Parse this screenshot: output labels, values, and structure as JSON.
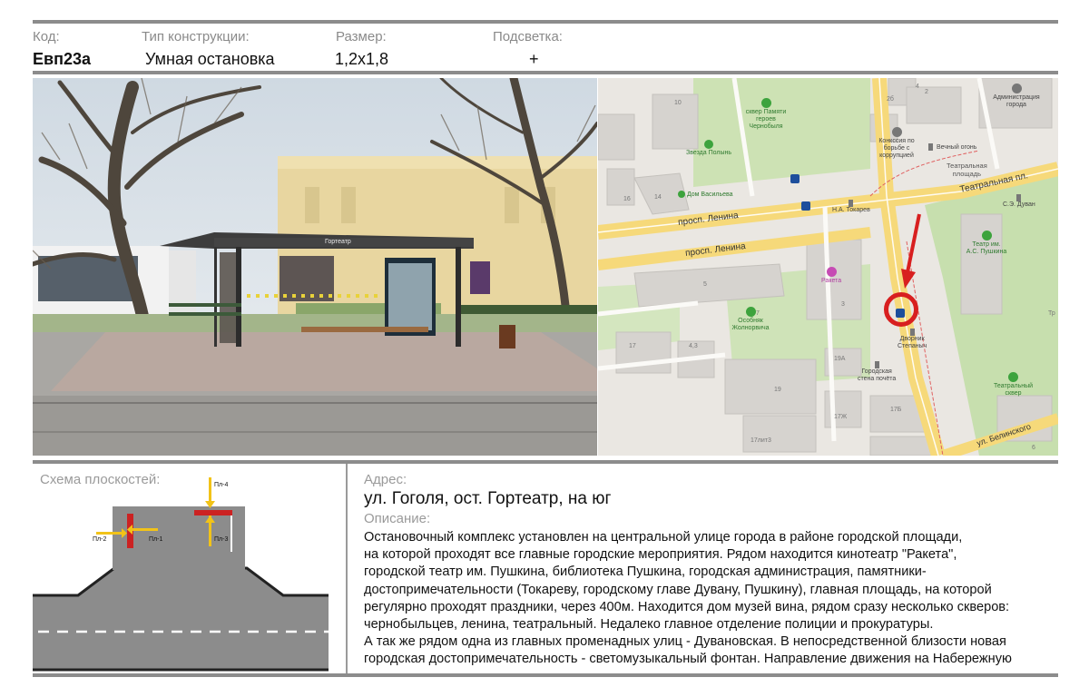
{
  "header": {
    "code_label": "Код:",
    "code_value": "Евп23а",
    "type_label": "Тип конструкции:",
    "type_value": "Умная остановка",
    "size_label": "Размер:",
    "size_value": "1,2х1,8",
    "light_label": "Подсветка:",
    "light_value": "+"
  },
  "photo": {
    "stop_sign": "Гортеатр"
  },
  "map": {
    "streets": [
      "просп. Ленина",
      "просп. Ленина",
      "Театральная пл.",
      "ул. Белинского"
    ],
    "places": [
      {
        "name": "сквер Памяти героев Чернобыля",
        "lines": [
          "сквер Памяти",
          "героев",
          "Чернобыля"
        ],
        "icon": "park-icon"
      },
      {
        "name": "Звезда Полынь",
        "lines": [
          "Звезда Полынь"
        ],
        "icon": "monument-icon"
      },
      {
        "name": "Дом Васильева",
        "lines": [
          "Дом Васильева"
        ],
        "icon": "monument-icon"
      },
      {
        "name": "Н.А. Токарев",
        "lines": [
          "Н.А. Токарев"
        ],
        "icon": "statue-icon"
      },
      {
        "name": "Конкссия по борьбе с коррупцией",
        "lines": [
          "Конкссия по",
          "борьбе с",
          "коррупцией"
        ],
        "icon": "flag-icon"
      },
      {
        "name": "Вечный огонь",
        "lines": [
          "Вечный огонь"
        ],
        "icon": "statue-icon"
      },
      {
        "name": "Театральная площадь",
        "lines": [
          "Театральная",
          "площадь"
        ],
        "icon": ""
      },
      {
        "name": "Администрация города",
        "lines": [
          "Администрация",
          "города"
        ],
        "icon": "flag-icon"
      },
      {
        "name": "С.Э. Дуван",
        "lines": [
          "С.Э. Дуван"
        ],
        "icon": "statue-icon"
      },
      {
        "name": "Театр им. А.С. Пушкина",
        "lines": [
          "Театр им.",
          "А.С. Пушкина"
        ],
        "icon": "theatre-icon"
      },
      {
        "name": "Ракета",
        "lines": [
          "Ракета"
        ],
        "icon": "cinema-icon"
      },
      {
        "name": "Особняк Жолнорвича",
        "lines": [
          "Особняк",
          "Жолнорвича"
        ],
        "icon": "monument-icon"
      },
      {
        "name": "Дворник Степаныч",
        "lines": [
          "Дворник",
          "Степаныч"
        ],
        "icon": "statue-icon"
      },
      {
        "name": "Городская стена почёта",
        "lines": [
          "Городская",
          "стена почёта"
        ],
        "icon": "statue-icon"
      },
      {
        "name": "Театральный сквер",
        "lines": [
          "Театральный",
          "сквер"
        ],
        "icon": "park-icon"
      }
    ],
    "house_numbers": [
      "10",
      "2б",
      "2",
      "16",
      "14",
      "5",
      "3",
      "7",
      "17",
      "4,3",
      "19А",
      "19",
      "17Ж",
      "17Б",
      "17лит3",
      "6",
      "4",
      "Тр"
    ]
  },
  "scheme": {
    "title": "Схема плоскостей:",
    "planes": [
      "Пл-1",
      "Пл-2",
      "Пл-3",
      "Пл-4"
    ]
  },
  "address": {
    "label": "Адрес:",
    "value": "ул. Гоголя, ост. Гортеатр, на юг"
  },
  "description": {
    "label": "Описание:",
    "lines": [
      "Остановочный комплекс установлен на центральной улице города в районе городской площади,",
      "на которой проходят все главные городские мероприятия. Рядом находится кинотеатр \"Ракета\",",
      "городской театр им. Пушкина, библиотека Пушкина, городская администрация, памятники-",
      "достопримечательности (Токареву, городскому главе Дувану, Пушкину), главная площадь, на которой",
      "регулярно проходят праздники, через 400м. Находится дом музей вина, рядом сразу несколько скверов:",
      "чернобыльцев, ленина, театральный. Недалеко главное отделение полиции и прокуратуры.",
      "А так же рядом одна из главных променадных улиц - Дувановская. В непосредственной близости новая",
      "городская достопримечательность -  светомузыкальный фонтан. Направление движения на Набережную"
    ]
  },
  "colors": {
    "frame": "#8c8c8c",
    "marker_ring": "#d81f1f",
    "arrow": "#d81f1f",
    "bus_stop": "#1d4f9c",
    "plane_red": "#cc2222",
    "plane_arrow": "#f2c318",
    "road": "#888888"
  }
}
